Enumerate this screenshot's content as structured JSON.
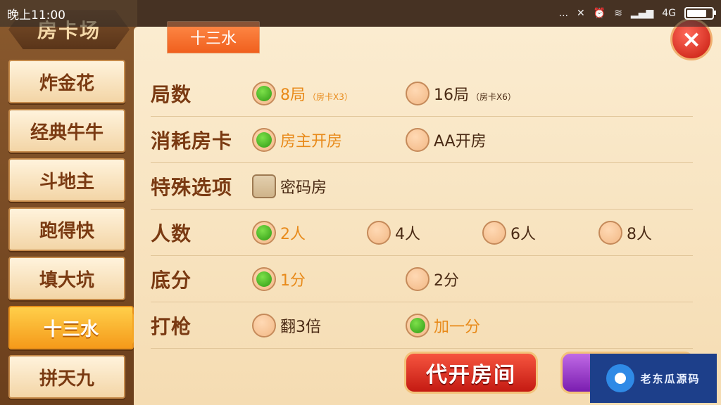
{
  "status_bar": {
    "time": "晚上11:00",
    "dots": "...",
    "signal_label": "4G"
  },
  "venue_title": "房卡场",
  "games": [
    {
      "label": "炸金花",
      "active": false
    },
    {
      "label": "经典牛牛",
      "active": false
    },
    {
      "label": "斗地主",
      "active": false
    },
    {
      "label": "跑得快",
      "active": false
    },
    {
      "label": "填大坑",
      "active": false
    },
    {
      "label": "十三水",
      "active": true
    },
    {
      "label": "拼天九",
      "active": false
    }
  ],
  "active_tab": "十三水",
  "close_icon": "×",
  "rows": {
    "rounds": {
      "label": "局数",
      "opt1": {
        "main": "8局",
        "sub": "（房卡X3）",
        "selected": true
      },
      "opt2": {
        "main": "16局",
        "sub": "（房卡X6）",
        "selected": false
      }
    },
    "card_cost": {
      "label": "消耗房卡",
      "opt1": {
        "main": "房主开房",
        "selected": true
      },
      "opt2": {
        "main": "AA开房",
        "selected": false
      }
    },
    "special": {
      "label": "特殊选项",
      "opt1": {
        "main": "密码房",
        "checked": false
      }
    },
    "players": {
      "label": "人数",
      "opt1": {
        "main": "2人",
        "selected": true
      },
      "opt2": {
        "main": "4人",
        "selected": false
      },
      "opt3": {
        "main": "6人",
        "selected": false
      },
      "opt4": {
        "main": "8人",
        "selected": false
      }
    },
    "base_score": {
      "label": "底分",
      "opt1": {
        "main": "1分",
        "selected": true
      },
      "opt2": {
        "main": "2分",
        "selected": false
      }
    },
    "gun": {
      "label": "打枪",
      "opt1": {
        "main": "翻3倍",
        "selected": false
      },
      "opt2": {
        "main": "加一分",
        "selected": true
      }
    }
  },
  "buttons": {
    "open_for_others": "代开房间"
  },
  "watermark_text": "老东瓜源码",
  "colors": {
    "selected_text": "#e88a1a",
    "label": "#7a3a12",
    "active_game": "#f59a1a"
  }
}
